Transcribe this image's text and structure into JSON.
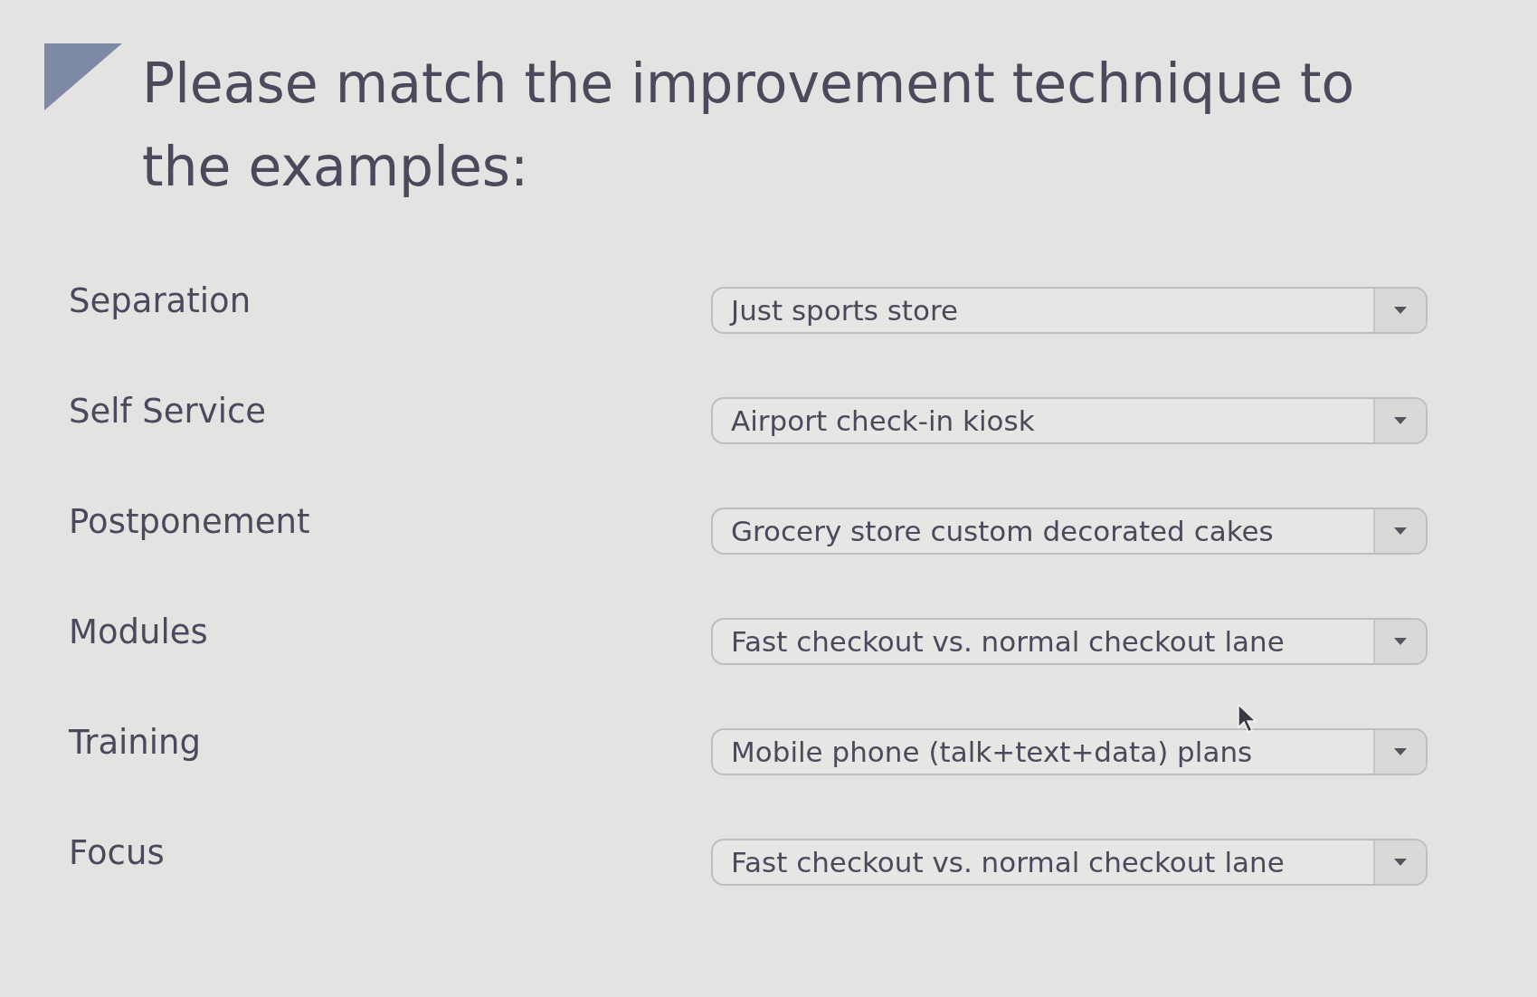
{
  "question": {
    "title": "Please match the improvement technique to the examples:"
  },
  "pairs": [
    {
      "term": "Separation",
      "answer": "Just sports store"
    },
    {
      "term": "Self Service",
      "answer": "Airport check-in kiosk"
    },
    {
      "term": "Postponement",
      "answer": "Grocery store custom decorated cakes"
    },
    {
      "term": "Modules",
      "answer": "Fast checkout vs. normal checkout lane"
    },
    {
      "term": "Training",
      "answer": "Mobile phone (talk+text+data) plans"
    },
    {
      "term": "Focus",
      "answer": "Fast checkout vs. normal checkout lane"
    }
  ]
}
